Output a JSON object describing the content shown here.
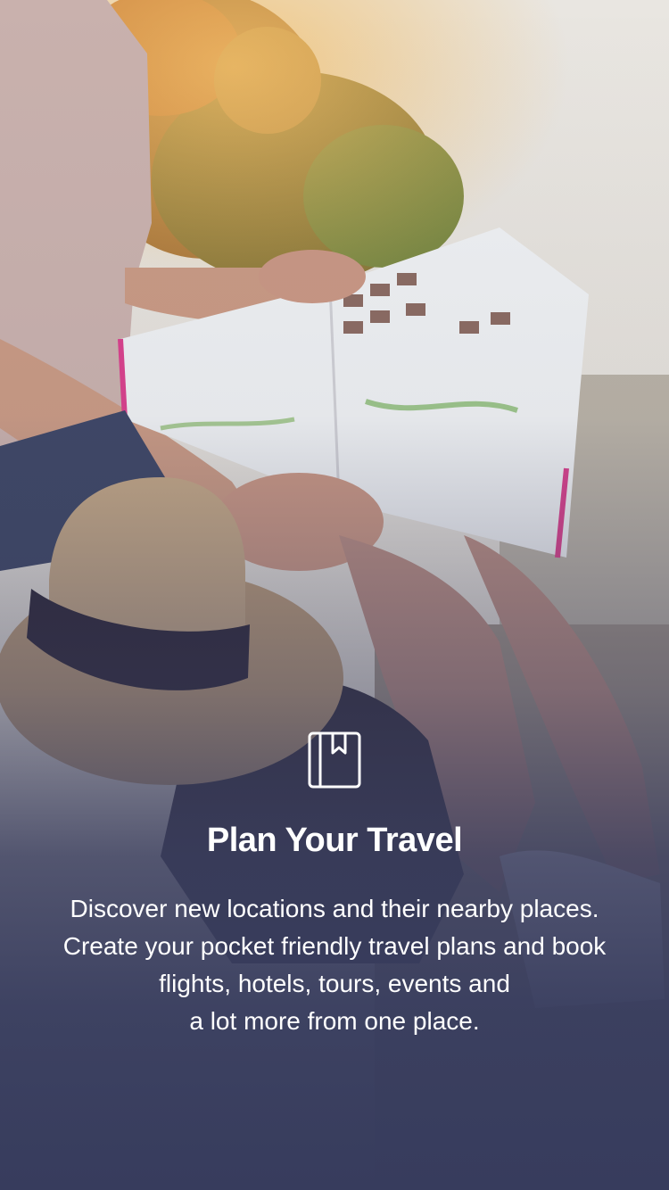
{
  "onboarding": {
    "icon": "book-bookmark-icon",
    "title": "Plan Your Travel",
    "description_lines": [
      "Discover new locations and their nearby places.",
      "Create your pocket friendly travel plans and book",
      "flights, hotels, tours, events and",
      "a lot more from one place."
    ]
  },
  "colors": {
    "overlay": "#3a3e5e",
    "text": "#ffffff",
    "hat_band": "#2c2637",
    "map_accent": "#d9418c"
  }
}
